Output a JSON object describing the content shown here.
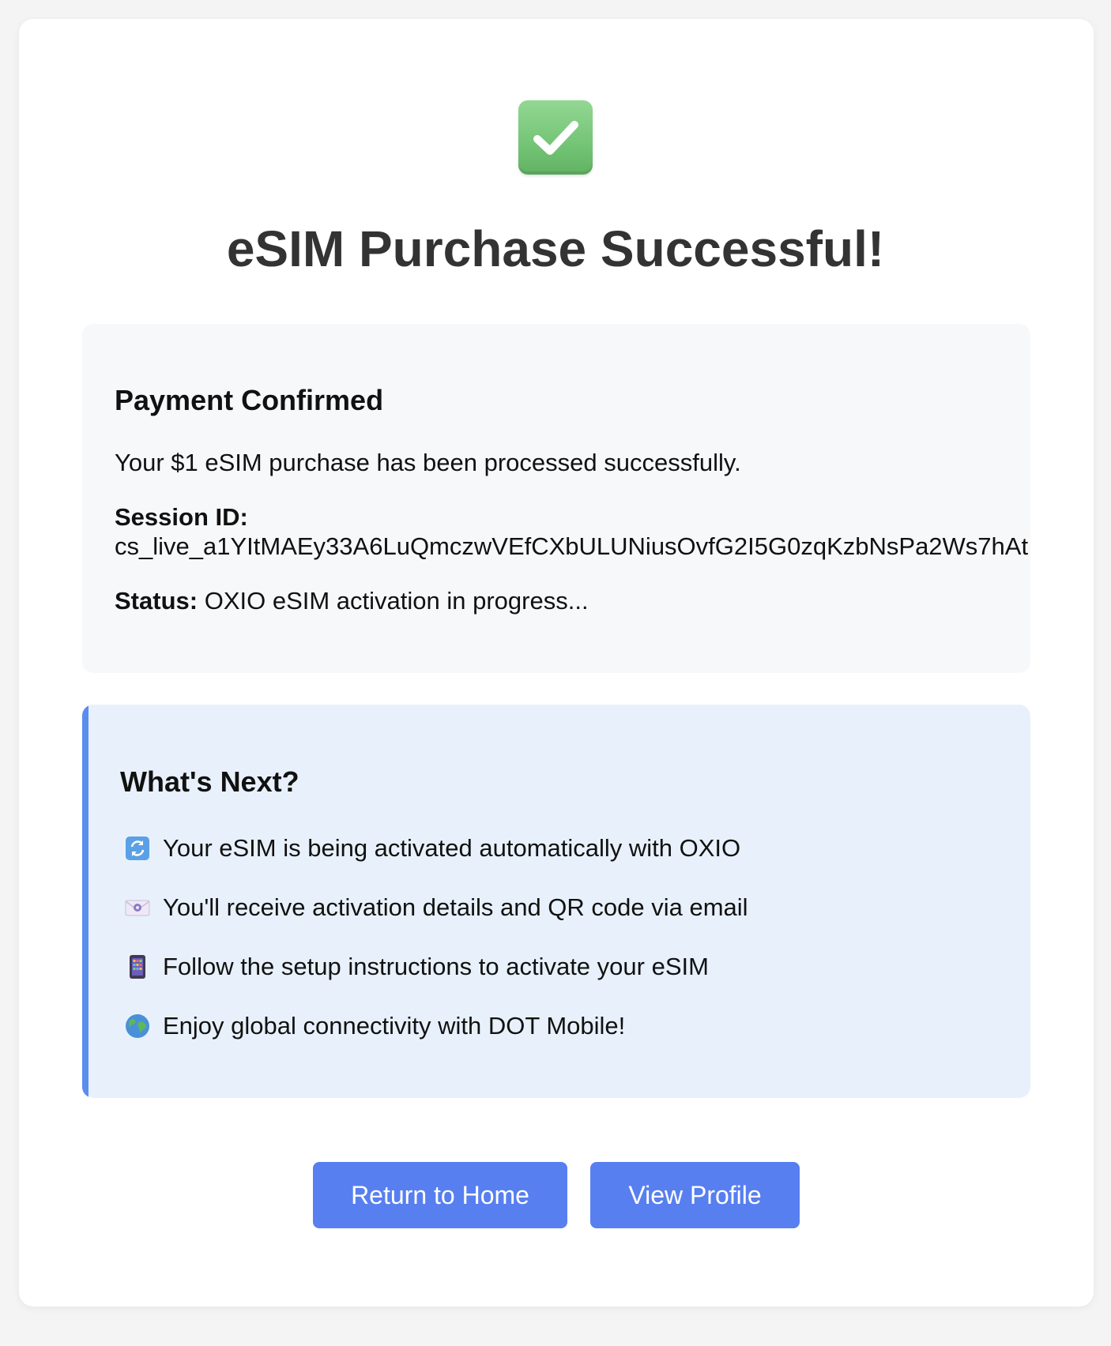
{
  "header": {
    "icon": "white-check-mark-icon",
    "title": "eSIM Purchase Successful!"
  },
  "payment": {
    "heading": "Payment Confirmed",
    "message": "Your $1 eSIM purchase has been processed successfully.",
    "session_label": "Session ID:",
    "session_id": "cs_live_a1YItMAEy33A6LuQmczwVEfCXbULUNiusOvfG2I5G0zqKzbNsPa2Ws7hAt",
    "status_label": "Status:",
    "status_value": "OXIO eSIM activation in progress..."
  },
  "next": {
    "heading": "What's Next?",
    "items": [
      {
        "icon": "arrows-counterclockwise-icon",
        "text": "Your eSIM is being activated automatically with OXIO"
      },
      {
        "icon": "email-icon",
        "text": "You'll receive activation details and QR code via email"
      },
      {
        "icon": "mobile-phone-icon",
        "text": "Follow the setup instructions to activate your eSIM"
      },
      {
        "icon": "globe-icon",
        "text": "Enjoy global connectivity with DOT Mobile!"
      }
    ]
  },
  "actions": {
    "home_label": "Return to Home",
    "profile_label": "View Profile"
  },
  "colors": {
    "accent": "#5b8def",
    "button": "#577ff0",
    "check_green": "#74c476"
  }
}
